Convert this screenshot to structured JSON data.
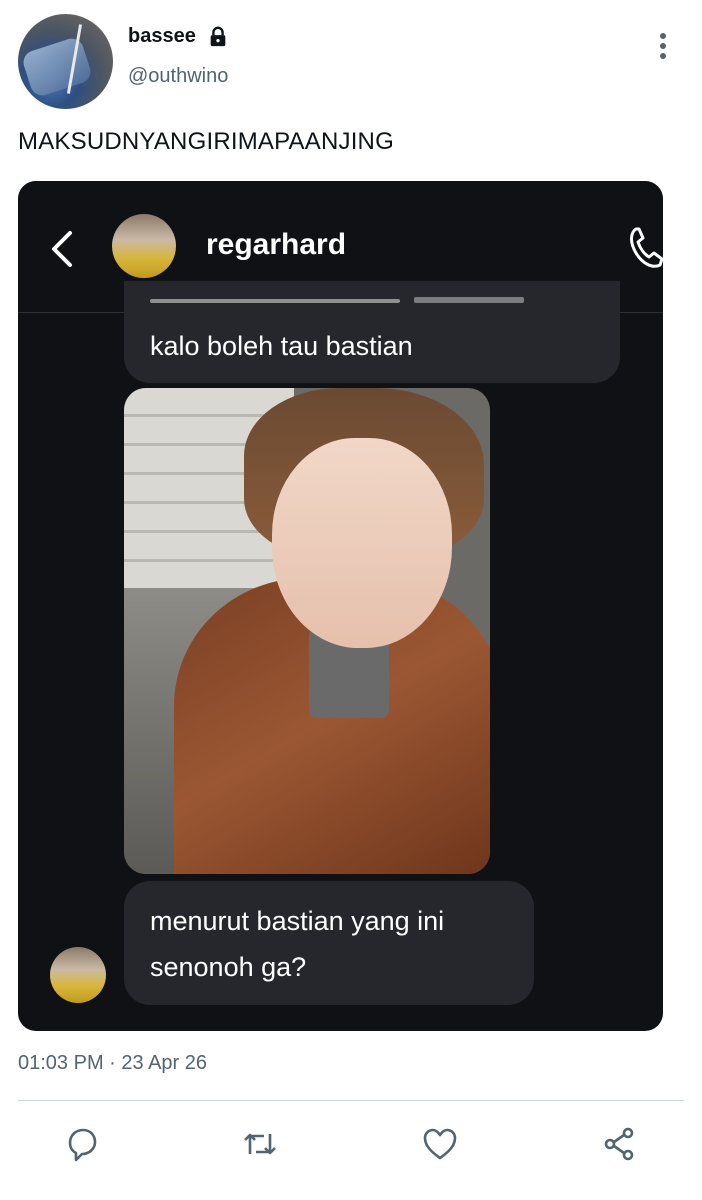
{
  "tweet": {
    "display_name": "bassee",
    "handle": "@outhwino",
    "text": "MAKSUDNYANGIRIMAPAANJING",
    "timestamp": "01:03 PM · 23 Apr 26"
  },
  "dm": {
    "contact_name": "regarhard",
    "messages": [
      {
        "text": "kalo boleh tau bastian"
      },
      {
        "lines": [
          "menurut bastian yang ini",
          "senonoh ga?"
        ]
      }
    ]
  },
  "icons": {
    "lock": "lock-icon",
    "more": "more-vertical-icon",
    "back": "chevron-left-icon",
    "phone": "phone-icon",
    "reply": "reply-icon",
    "retweet": "retweet-icon",
    "like": "heart-icon",
    "share": "share-icon"
  },
  "colors": {
    "dm_background": "#0f1115",
    "bubble": "#25272c",
    "secondary_text": "#536471"
  }
}
